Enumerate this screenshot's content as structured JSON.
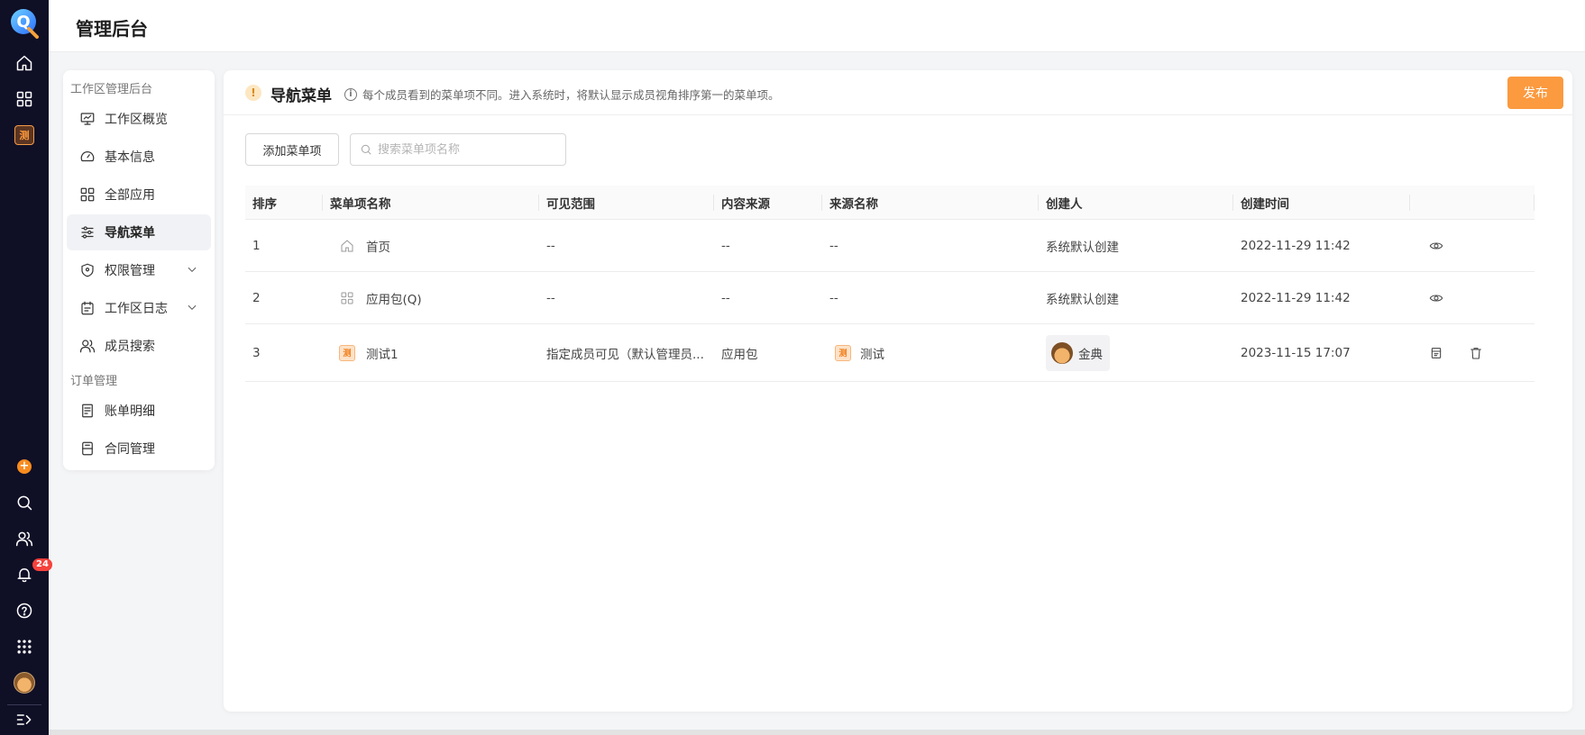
{
  "header": {
    "title": "管理后台"
  },
  "rail": {
    "logo_letter": "Q",
    "app_tile": "测",
    "notification_count": "24"
  },
  "sidebar": {
    "group1": "工作区管理后台",
    "group2": "订单管理",
    "items": [
      {
        "label": "工作区概览",
        "icon": "monitor-icon"
      },
      {
        "label": "基本信息",
        "icon": "dashboard-icon"
      },
      {
        "label": "全部应用",
        "icon": "apps-grid-icon"
      },
      {
        "label": "导航菜单",
        "icon": "sliders-icon",
        "active": true
      },
      {
        "label": "权限管理",
        "icon": "shield-icon",
        "expandable": true
      },
      {
        "label": "工作区日志",
        "icon": "calendar-icon",
        "expandable": true
      },
      {
        "label": "成员搜索",
        "icon": "users-icon"
      },
      {
        "label": "账单明细",
        "icon": "receipt-icon"
      },
      {
        "label": "合同管理",
        "icon": "contract-icon"
      }
    ]
  },
  "main": {
    "title": "导航菜单",
    "warn_glyph": "!",
    "info_glyph": "i",
    "hint": "每个成员看到的菜单项不同。进入系统时，将默认显示成员视角排序第一的菜单项。",
    "publish_label": "发布",
    "add_label": "添加菜单项",
    "search_placeholder": "搜索菜单项名称"
  },
  "table": {
    "columns": [
      "排序",
      "菜单项名称",
      "可见范围",
      "内容来源",
      "来源名称",
      "创建人",
      "创建时间",
      ""
    ],
    "rows": [
      {
        "order": "1",
        "name": "首页",
        "icon": "home-icon",
        "scope": "--",
        "source": "--",
        "source_name": "--",
        "creator": "系统默认创建",
        "created": "2022-11-29 11:42"
      },
      {
        "order": "2",
        "name": "应用包(Q)",
        "icon": "apps-grid-icon",
        "scope": "--",
        "source": "--",
        "source_name": "--",
        "creator": "系统默认创建",
        "created": "2022-11-29 11:42"
      },
      {
        "order": "3",
        "name": "测试1",
        "icon": "app-tile-icon",
        "tile": "测",
        "scope": "指定成员可见（默认管理员...",
        "source": "应用包",
        "source_name": "测试",
        "source_tile": "测",
        "creator": "金典",
        "created": "2023-11-15 17:07"
      }
    ]
  }
}
